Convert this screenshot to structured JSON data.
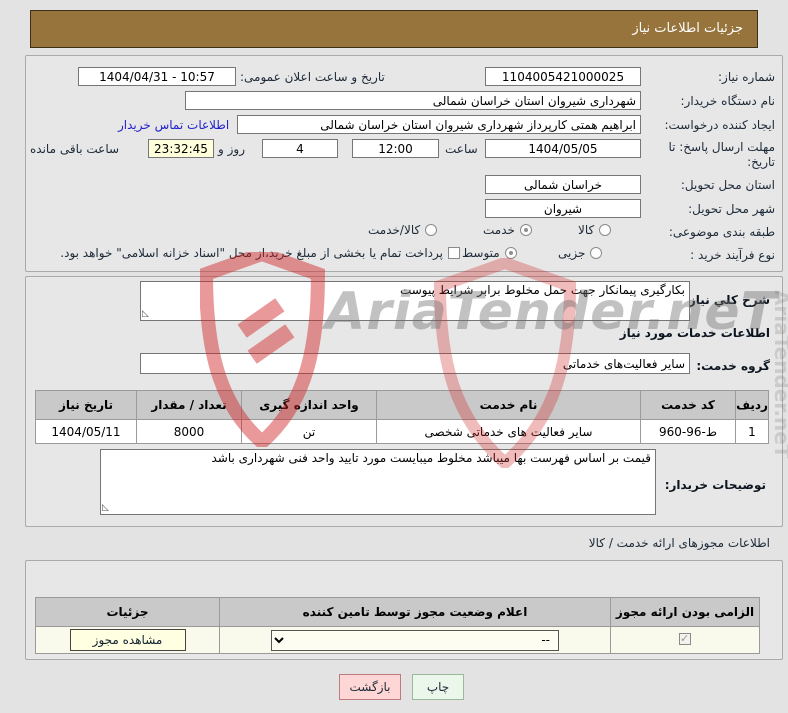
{
  "title_bar": {
    "title": "جزئیات اطلاعات نیاز"
  },
  "info": {
    "need_number": {
      "label": "شماره نیاز:",
      "value": "1104005421000025"
    },
    "announce": {
      "label": "تاریخ و ساعت اعلان عمومی:",
      "value": "1404/04/31 - 10:57"
    },
    "buyer_name": {
      "label": "نام دستگاه خریدار:",
      "value": "شهرداری شیروان استان خراسان شمالی"
    },
    "creator": {
      "label": "ایجاد کننده درخواست:",
      "value": "ابراهیم همتی کارپرداز شهرداری شیروان استان خراسان شمالی",
      "contact_link": "اطلاعات تماس خریدار"
    },
    "deadline": {
      "label": "مهلت ارسال پاسخ: تا تاریخ:",
      "date": "1404/05/05",
      "hour_label": "ساعت",
      "time": "12:00",
      "days": "4",
      "days_label": "روز و",
      "remaining": "23:32:45",
      "remaining_label": "ساعت باقی مانده"
    },
    "province": {
      "label": "استان محل تحویل:",
      "value": "خراسان شمالی"
    },
    "city": {
      "label": "شهر محل تحویل:",
      "value": "شیروان"
    },
    "classification": {
      "label": "طبقه بندی موضوعی:",
      "options": [
        "کالا",
        "خدمت",
        "کالا/خدمت"
      ],
      "selected": "خدمت"
    },
    "process_type": {
      "label": "نوع فرآیند خرید :",
      "options": [
        "جزیی",
        "متوسط"
      ],
      "selected": "متوسط",
      "treasury_checkbox_label": "پرداخت تمام یا بخشی از مبلغ خرید،از محل \"اسناد خزانه اسلامی\" خواهد بود.",
      "treasury_checked": false
    }
  },
  "description": {
    "label": "شرح کلي نیاز:",
    "value": "بکارگیری پیمانکار جهت حمل مخلوط برابر شرایط پیوست"
  },
  "services": {
    "heading": "اطلاعات خدمات مورد نیاز",
    "group": {
      "label": "گروه خدمت:",
      "value": "سایر فعالیت‌های خدماتی"
    },
    "table": {
      "headers": [
        "ردیف",
        "کد خدمت",
        "نام خدمت",
        "واحد اندازه گیری",
        "تعداد / مقدار",
        "تاریخ نیاز"
      ],
      "rows": [
        [
          "1",
          "ط-96-960",
          "سایر فعالیت های خدماتی شخصی",
          "تن",
          "8000",
          "1404/05/11"
        ]
      ]
    }
  },
  "buyer_notes": {
    "label": "توضیحات خریدار:",
    "value": "قیمت بر اساس فهرست بها میباشد مخلوط میبایست مورد تایید واحد فنی شهرداری باشد"
  },
  "permits": {
    "heading": "اطلاعات مجوزهای ارائه خدمت / کالا",
    "table": {
      "headers": [
        "الزامی بودن ارائه مجوز",
        "اعلام وضعیت مجوز توسط تامین کننده",
        "جزئیات"
      ],
      "row": {
        "required_checked": true,
        "status_value": "--",
        "details_button": "مشاهده مجوز"
      }
    }
  },
  "footer": {
    "back_button": "بازگشت",
    "print_button": "چاپ"
  },
  "watermark": {
    "text": "AriaTender.neT"
  },
  "colors": {
    "title_bg": "#96743c",
    "remaining_bg": "#ffffdc",
    "back_bg": "#ffd6d6",
    "print_bg": "#eaf7ea",
    "table_header_bg": "#c9c9c9",
    "permit_row_bg": "#fafaec",
    "link": "#2222cc"
  }
}
